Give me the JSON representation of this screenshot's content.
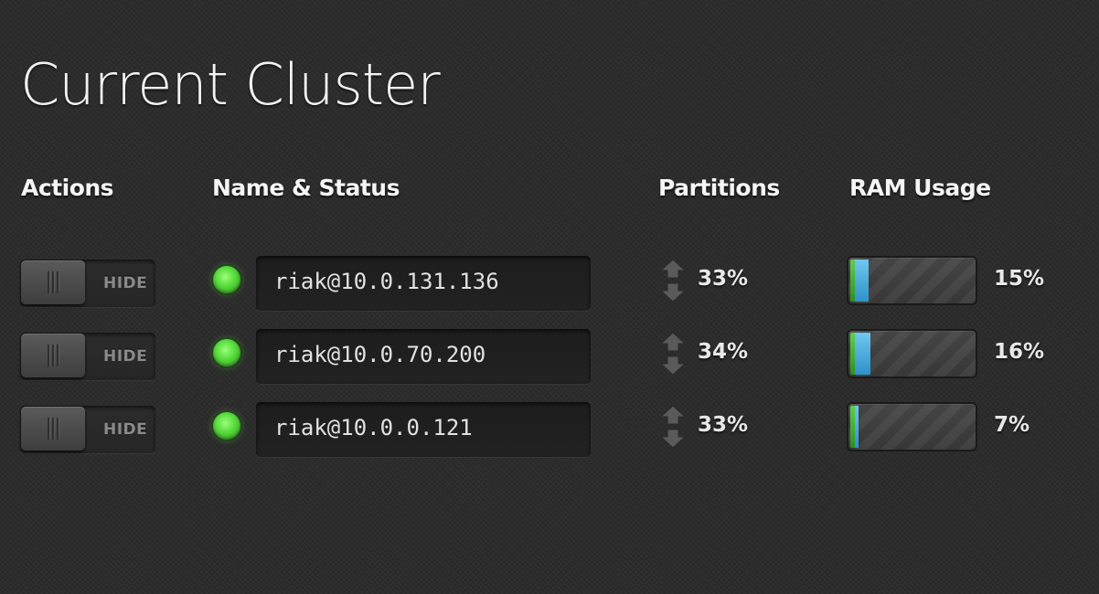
{
  "page": {
    "title": "Current Cluster"
  },
  "columns": {
    "actions": "Actions",
    "name_status": "Name & Status",
    "partitions": "Partitions",
    "ram_usage": "RAM Usage"
  },
  "colors": {
    "status_online": "#55d93a",
    "ram_blue": "#4fb3e4",
    "ram_green": "#4bb63a",
    "background": "#2a2a2a"
  },
  "nodes": [
    {
      "toggle_label": "HIDE",
      "status": "online",
      "name": "riak@10.0.131.136",
      "partitions": "33%",
      "ram_usage": "15%",
      "ram_fraction": 0.15
    },
    {
      "toggle_label": "HIDE",
      "status": "online",
      "name": "riak@10.0.70.200",
      "partitions": "34%",
      "ram_usage": "16%",
      "ram_fraction": 0.16
    },
    {
      "toggle_label": "HIDE",
      "status": "online",
      "name": "riak@10.0.0.121",
      "partitions": "33%",
      "ram_usage": "7%",
      "ram_fraction": 0.07
    }
  ],
  "icons": {
    "toggle": "toggle-switch-icon",
    "status": "status-led-icon",
    "partition_up": "arrow-up-icon",
    "partition_down": "arrow-down-icon"
  }
}
